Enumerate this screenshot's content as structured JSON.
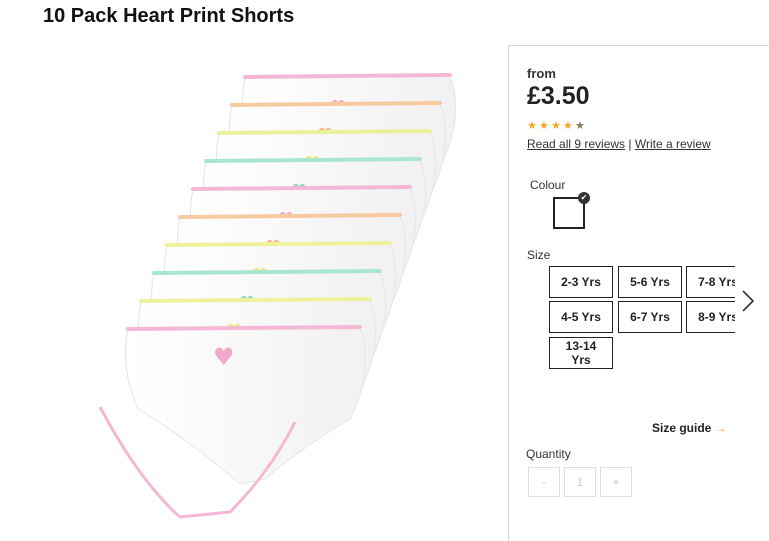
{
  "product": {
    "title": "10 Pack Heart Print Shorts"
  },
  "pricing": {
    "from_label": "from",
    "price": "£3.50"
  },
  "rating": {
    "stars_filled": 4,
    "stars_total": 5,
    "read_reviews": "Read all 9 reviews",
    "separator": "|",
    "write_review": "Write a review",
    "star_color": "#f5a623"
  },
  "colour": {
    "label": "Colour",
    "selected_swatch": "white",
    "check_icon": "check-icon"
  },
  "size": {
    "label": "Size",
    "options": [
      "2-3 Yrs",
      "5-6 Yrs",
      "7-8 Yrs",
      "4-5 Yrs",
      "6-7 Yrs",
      "8-9 Yrs",
      "13-14 Yrs"
    ],
    "next_icon": "chevron-right-icon"
  },
  "size_guide": {
    "label": "Size guide",
    "arrow_icon": "arrow-right-icon"
  },
  "quantity": {
    "label": "Quantity",
    "decrement": "-",
    "value": "1",
    "increment": "+"
  }
}
